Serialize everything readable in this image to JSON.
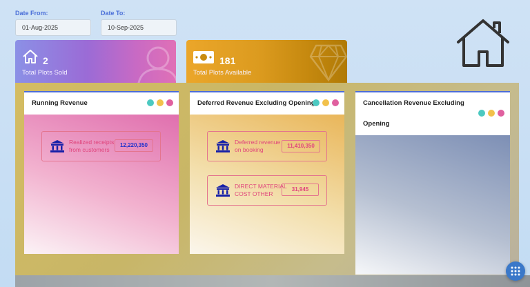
{
  "filters": {
    "date_from_label": "Date From:",
    "date_from_value": "01-Aug-2025",
    "date_to_label": "Date To:",
    "date_to_value": "10-Sep-2025"
  },
  "stats": {
    "plots_sold": {
      "value": "2",
      "label": "Total Plots Sold"
    },
    "plots_available": {
      "value": "181",
      "label": "Total Plots Available"
    }
  },
  "cards": {
    "running": {
      "title": "Running Revenue",
      "items": [
        {
          "label_line1": "Realized receipts",
          "label_line2": "from customers",
          "value": "12,220,350"
        }
      ]
    },
    "deferred": {
      "title": "Deferred Revenue Excluding Opening",
      "items": [
        {
          "label_line1": "Deferred revenue",
          "label_line2": "on booking",
          "value": "11,410,350"
        },
        {
          "label_line1": "DIRECT MATERIAL",
          "label_line2": "COST OTHER",
          "value": "31,945"
        }
      ]
    },
    "cancellation": {
      "title_line1": "Cancellation Revenue Excluding",
      "title_line2": "Opening"
    }
  },
  "colors": {
    "accent": "#4c6cd8",
    "dot_teal": "#4cc9c1",
    "dot_yellow": "#f2c14b",
    "dot_pink": "#e0609f",
    "item_text": "#e0457c",
    "value_blue": "#2233cc"
  },
  "icons": {
    "home": "home-icon",
    "sold": "house-icon",
    "available": "money-icon",
    "bank": "bank-icon",
    "menu": "grid-icon"
  }
}
